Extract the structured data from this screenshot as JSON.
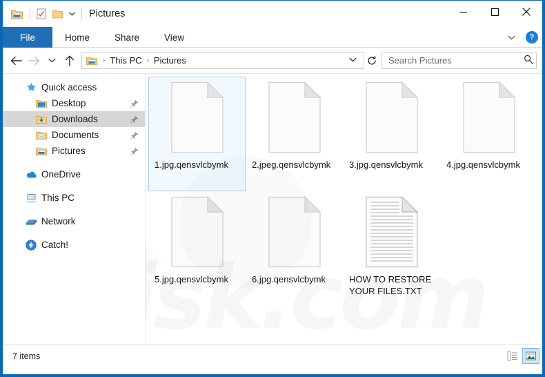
{
  "window": {
    "title": "Pictures",
    "accent_color": "#0b68b6",
    "file_tab_color": "#1e6fb8"
  },
  "titlebar": {
    "quick_access": [
      {
        "name": "pictures-folder-icon",
        "label": "Pictures"
      },
      {
        "name": "properties-icon",
        "label": "Properties"
      },
      {
        "name": "new-folder-icon",
        "label": "New folder"
      }
    ],
    "customize_label": "Customize Quick Access Toolbar",
    "minimize_label": "Minimize",
    "maximize_label": "Maximize",
    "close_label": "Close"
  },
  "ribbon": {
    "tabs": [
      {
        "label": "File",
        "active": true
      },
      {
        "label": "Home",
        "active": false
      },
      {
        "label": "Share",
        "active": false
      },
      {
        "label": "View",
        "active": false
      }
    ],
    "expand_label": "Expand the Ribbon",
    "help_label": "?"
  },
  "address": {
    "back_label": "Back",
    "forward_label": "Forward",
    "history_label": "Recent locations",
    "up_label": "Up to This PC",
    "breadcrumbs": [
      "This PC",
      "Pictures"
    ],
    "separator": "›",
    "dropdown_label": "Previous locations",
    "refresh_label": "Refresh Pictures"
  },
  "search": {
    "placeholder": "Search Pictures",
    "value": "",
    "icon": "search-icon"
  },
  "sidebar": {
    "items": [
      {
        "label": "Quick access",
        "icon": "star-icon",
        "level": "root",
        "pinned": false,
        "highlighted": false,
        "gap_before": false
      },
      {
        "label": "Desktop",
        "icon": "desktop-folder-icon",
        "level": "child",
        "pinned": true,
        "highlighted": false,
        "gap_before": false
      },
      {
        "label": "Downloads",
        "icon": "downloads-folder-icon",
        "level": "child",
        "pinned": true,
        "highlighted": true,
        "gap_before": false
      },
      {
        "label": "Documents",
        "icon": "documents-folder-icon",
        "level": "child",
        "pinned": true,
        "highlighted": false,
        "gap_before": false
      },
      {
        "label": "Pictures",
        "icon": "pictures-folder-icon",
        "level": "child",
        "pinned": true,
        "highlighted": false,
        "gap_before": false
      },
      {
        "label": "OneDrive",
        "icon": "onedrive-cloud-icon",
        "level": "root",
        "pinned": false,
        "highlighted": false,
        "gap_before": true
      },
      {
        "label": "This PC",
        "icon": "this-pc-icon",
        "level": "root",
        "pinned": false,
        "highlighted": false,
        "gap_before": true
      },
      {
        "label": "Network",
        "icon": "network-icon",
        "level": "root",
        "pinned": false,
        "highlighted": false,
        "gap_before": true
      },
      {
        "label": "Catch!",
        "icon": "catch-lightning-icon",
        "level": "root",
        "pinned": false,
        "highlighted": false,
        "gap_before": true
      }
    ]
  },
  "files": [
    {
      "name": "1.jpg.qensvlcbymk",
      "icon": "blank-document-icon",
      "selected": true
    },
    {
      "name": "2.jpeg.qensvlcbymk",
      "icon": "blank-document-icon",
      "selected": false
    },
    {
      "name": "3.jpg.qensvlcbymk",
      "icon": "blank-document-icon",
      "selected": false
    },
    {
      "name": "4.jpg.qensvlcbymk",
      "icon": "blank-document-icon",
      "selected": false
    },
    {
      "name": "5.jpg.qensvlcbymk",
      "icon": "blank-document-icon",
      "selected": false
    },
    {
      "name": "6.jpg.qensvlcbymk",
      "icon": "blank-document-icon",
      "selected": false
    },
    {
      "name": "HOW TO RESTORE YOUR FILES.TXT",
      "icon": "text-document-icon",
      "selected": false
    }
  ],
  "statusbar": {
    "item_count_text": "7 items",
    "details_view_label": "Details view",
    "large_icons_view_label": "Large icons view"
  },
  "watermark": {
    "text": "pcrisk.com"
  }
}
